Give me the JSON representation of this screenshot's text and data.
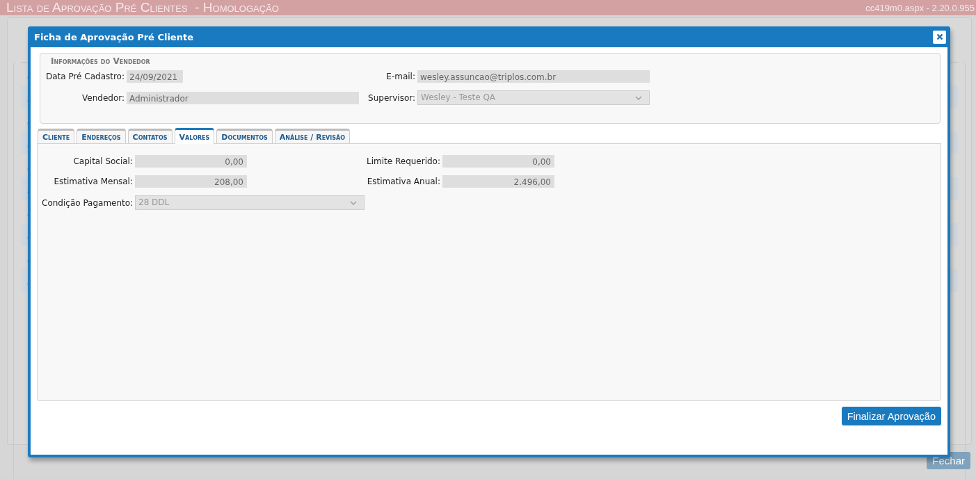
{
  "page": {
    "title": "Lista de Aprovação Pré Clientes  - Homologação",
    "version": "cc419m0.aspx - 2.20.0.955",
    "close_button": {
      "label": "Fechar",
      "disabled": true
    }
  },
  "dialog": {
    "title": "Ficha de Aprovação Pré Cliente",
    "seller_section": {
      "legend": "Informações do Vendedor",
      "fields": [
        {
          "label": "Data Pré Cadastro:",
          "value": "24/09/2021",
          "kind": "short",
          "disabled": true
        },
        {
          "label": "E-mail:",
          "value": "wesley.assuncao@triplos.com.br",
          "kind": "text",
          "disabled": true
        },
        {
          "label": "Vendedor:",
          "value": "Administrador",
          "kind": "text",
          "disabled": true
        },
        {
          "label": "Supervisor:",
          "value": "Wesley - Teste QA",
          "kind": "select",
          "disabled": true
        }
      ]
    },
    "tabs": [
      {
        "label": "Cliente",
        "selected": false
      },
      {
        "label": "Endereços",
        "selected": false
      },
      {
        "label": "Contatos",
        "selected": false
      },
      {
        "label": "Valores",
        "selected": true
      },
      {
        "label": "Documentos",
        "selected": false
      },
      {
        "label": "Análise / Revisão",
        "selected": false
      }
    ],
    "values_fields": [
      {
        "label": "Capital Social:",
        "value": "0,00",
        "kind": "number",
        "disabled": true
      },
      {
        "label": "Limite Requerido:",
        "value": "0,00",
        "kind": "number",
        "disabled": true
      },
      {
        "label": "Estimativa Mensal:",
        "value": "208,00",
        "kind": "number",
        "disabled": true
      },
      {
        "label": "Estimativa Anual:",
        "value": "2.496,00",
        "kind": "number",
        "disabled": true
      },
      {
        "label": "Condição Pagamento:",
        "value": "28 DDL",
        "kind": "select",
        "disabled": true
      }
    ],
    "primary_button": "Finalizar Aprovação"
  }
}
